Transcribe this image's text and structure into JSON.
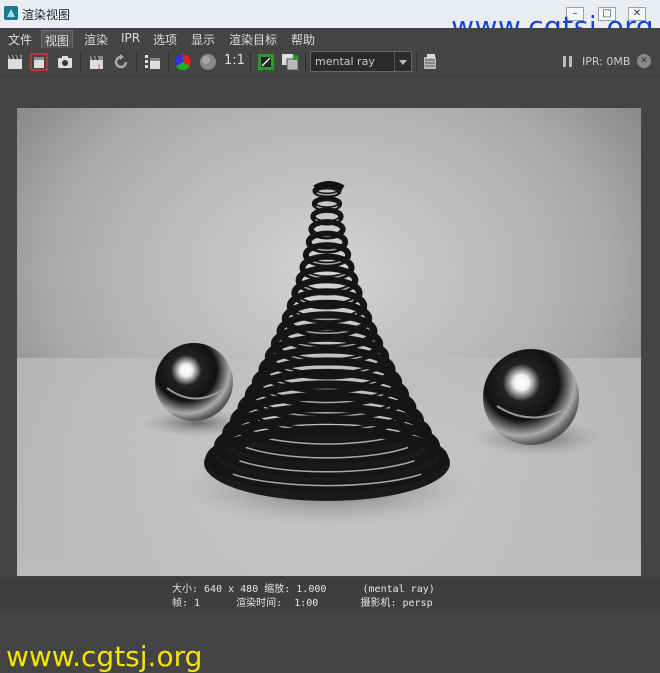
{
  "window": {
    "title": "渲染视图",
    "min_glyph": "–",
    "max_glyph": "□",
    "close_glyph": "✕"
  },
  "watermarks": {
    "top": "www.cgtsj.org",
    "bottom": "www.cgtsj.org"
  },
  "menu": {
    "items": [
      "文件",
      "视图",
      "渲染",
      "IPR",
      "选项",
      "显示",
      "渲染目标",
      "帮助"
    ],
    "active_index": 1
  },
  "toolbar": {
    "ratio_label": "1:1",
    "renderer": "mental ray",
    "ipr_status": "IPR: 0MB",
    "icons": [
      "render-clapper-icon",
      "render-region-icon",
      "snapshot-camera-icon",
      "ipr-clapper-icon",
      "refresh-ipr-icon",
      "render-sequence-icon",
      "rgb-channels-icon",
      "alpha-channel-icon",
      "color-manage-icon",
      "keep-image-icon",
      "render-settings-icon"
    ]
  },
  "status": {
    "line1": "大小: 640 x 480 缩放: 1.000      (mental ray)",
    "line2": "帧: 1      渲染时间:  1:00       摄影机: persp"
  }
}
